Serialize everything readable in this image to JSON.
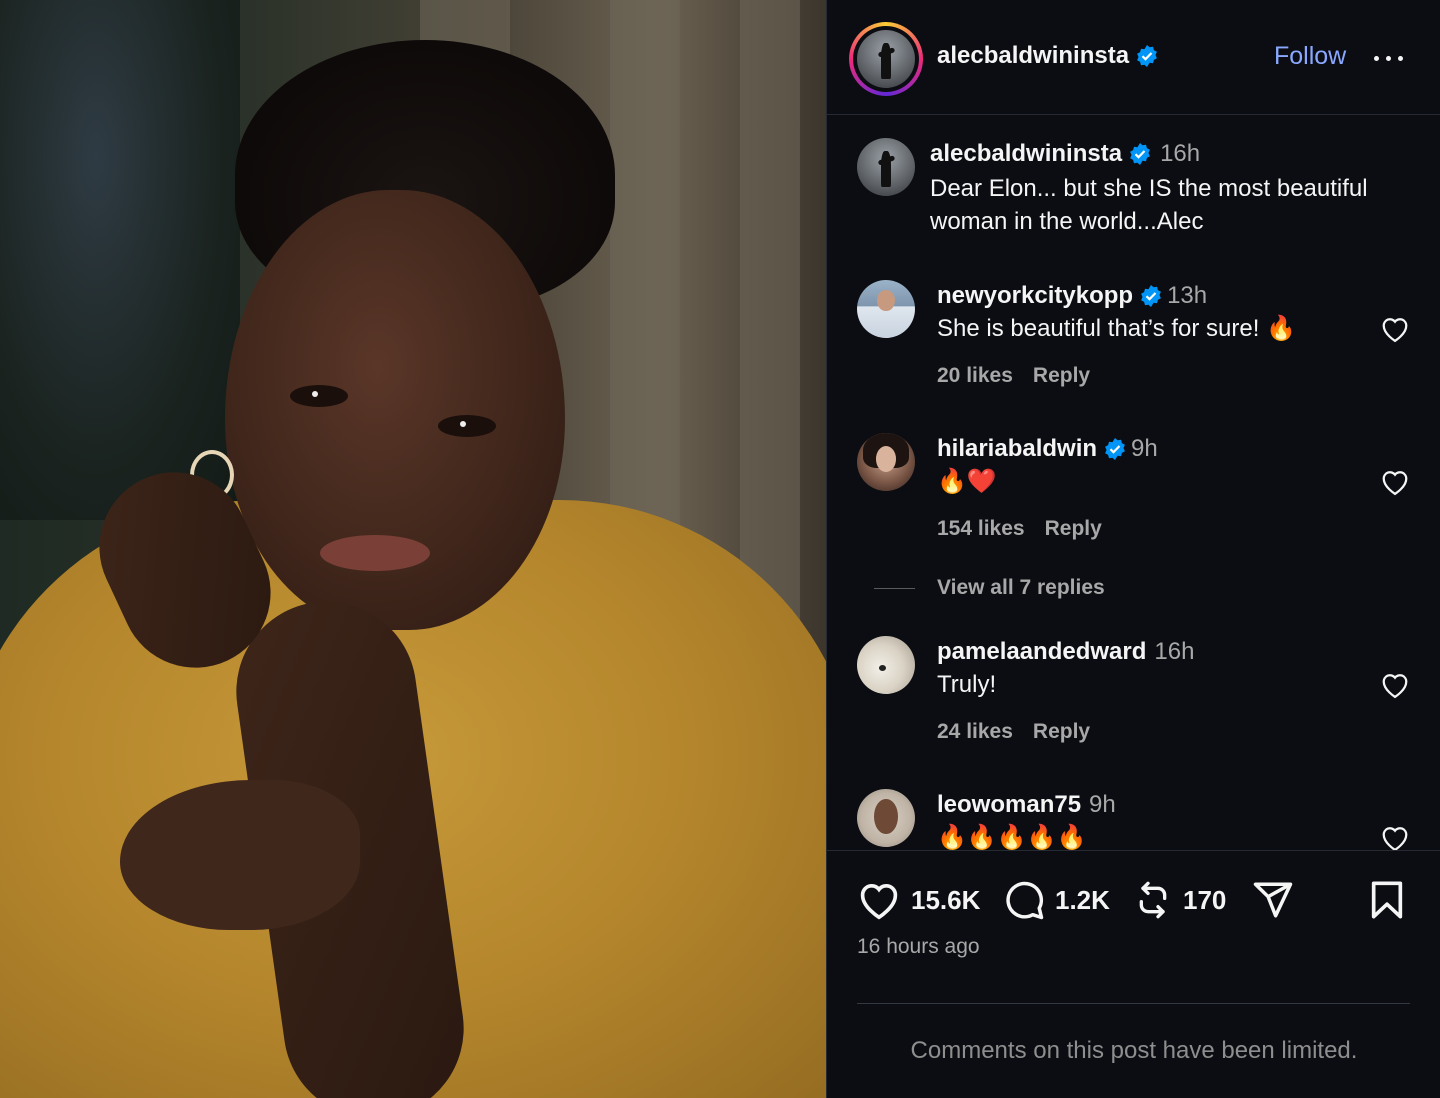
{
  "post": {
    "author": "alecbaldwininsta",
    "follow_label": "Follow",
    "caption": {
      "username": "alecbaldwininsta",
      "time": "16h",
      "text": "Dear Elon... but she IS the most beautiful woman in the world...Alec"
    }
  },
  "comments": [
    {
      "username": "newyorkcitykopp",
      "verified": true,
      "time": "13h",
      "text": "She is beautiful that’s for sure! 🔥",
      "likes": "20 likes",
      "reply_label": "Reply"
    },
    {
      "username": "hilariabaldwin",
      "verified": true,
      "time": "9h",
      "text": "🔥❤️",
      "likes": "154 likes",
      "reply_label": "Reply",
      "view_replies": "View all 7 replies"
    },
    {
      "username": "pamelaandedward",
      "verified": false,
      "time": "16h",
      "text": "Truly!",
      "likes": "24 likes",
      "reply_label": "Reply"
    },
    {
      "username": "leowoman75",
      "verified": false,
      "time": "9h",
      "text": "🔥🔥🔥🔥🔥"
    }
  ],
  "stats": {
    "likes": "15.6K",
    "comments": "1.2K",
    "reposts": "170"
  },
  "posted_ago": "16 hours ago",
  "limited_notice": "Comments on this post have been limited.",
  "colors": {
    "background": "#0b0d12",
    "follow": "#8aa8ff",
    "verified": "#0095f6",
    "muted": "#a8a8a8"
  },
  "icons": [
    "verified-badge-icon",
    "more-options-icon",
    "heart-icon",
    "comment-icon",
    "repost-icon",
    "share-icon",
    "bookmark-icon"
  ]
}
